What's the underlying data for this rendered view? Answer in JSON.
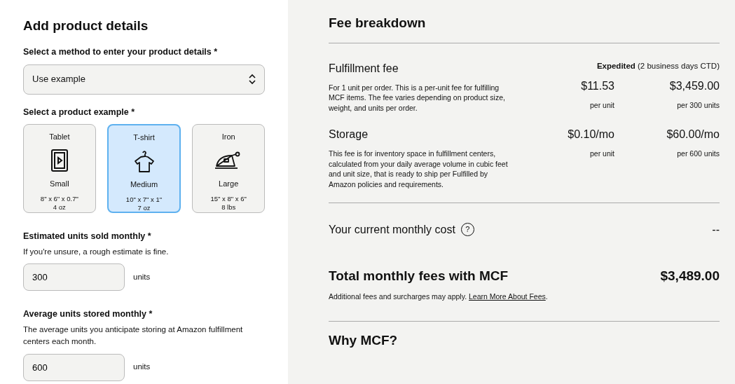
{
  "left": {
    "title": "Add product details",
    "method": {
      "label": "Select a method to enter your product details *",
      "value": "Use example"
    },
    "example_label": "Select a product example *",
    "products": [
      {
        "name": "Tablet",
        "kind": "tablet",
        "size": "Small",
        "dims": "8\" x 6\" x 0.7\"",
        "weight": "4 oz",
        "selected": false
      },
      {
        "name": "T-shirt",
        "kind": "tshirt",
        "size": "Medium",
        "dims": "10\" x 7\" x 1\"",
        "weight": "7 oz",
        "selected": true
      },
      {
        "name": "Iron",
        "kind": "iron",
        "size": "Large",
        "dims": "15\" x 8\" x 6\"",
        "weight": "8 lbs",
        "selected": false
      }
    ],
    "fields": [
      {
        "label": "Estimated units sold monthly *",
        "hint": "If you're unsure, a rough estimate is fine.",
        "value": "300",
        "unit": "units"
      },
      {
        "label": "Average units stored monthly *",
        "hint": "The average units you anticipate storing at Amazon fulfillment centers each month.",
        "value": "600",
        "unit": "units"
      }
    ]
  },
  "right": {
    "title": "Fee breakdown",
    "shipping": "**Expedited** (2 business days CTD)",
    "fees": [
      {
        "name": "Fulfillment fee",
        "description": "For 1 unit per order. This is a per-unit fee for fulfilling MCF items. The fee varies depending on product size, weight, and units per order.",
        "unit_price": "$11.53",
        "unit_caption": "per unit",
        "total": "$3,459.00",
        "total_caption": "per 300 units"
      },
      {
        "name": "Storage",
        "description": "This fee is for inventory space in fulfillment centers, calculated from your daily average volume in cubic feet and unit size, that is ready to ship per Fulfilled by Amazon policies and requirements.",
        "unit_price": "$0.10/mo",
        "unit_caption": "per unit",
        "total": "$60.00/mo",
        "total_caption": "per 600 units"
      }
    ],
    "current_cost": {
      "label": "Your current monthly cost",
      "help": "?",
      "value": "--"
    },
    "total": {
      "label": "Total monthly fees with MCF",
      "value": "$3,489.00"
    },
    "note": {
      "text": "Additional fees and surcharges may apply.",
      "link": "Learn More About Fees",
      "end": "."
    },
    "next_heading": "Why MCF?"
  }
}
